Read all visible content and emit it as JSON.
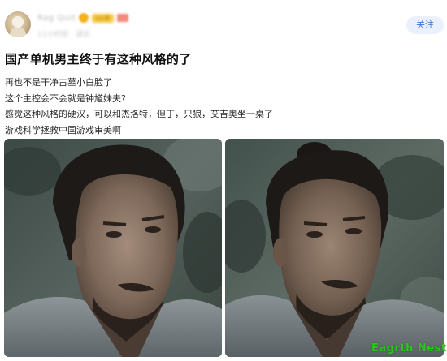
{
  "post": {
    "author": {
      "name": "Rag Quit",
      "badge": "Lv.8",
      "meta": "11小时前 · 湖北"
    },
    "follow_label": "关注",
    "title": "国产单机男主终于有这种风格的了",
    "lines": [
      "再也不是干净古墓小白脸了",
      "这个主控会不会就是钟馗妹夫?",
      "感觉这种风格的硬汉，可以和杰洛特，但丁，只狼，艾吉奥坐一桌了",
      "游戏科学拯救中国游戏审美啊"
    ]
  },
  "images": [
    {
      "description_icon": "portrait-photo-icon"
    },
    {
      "description_icon": "portrait-photo-icon"
    }
  ],
  "watermark": "Eagrth Nest",
  "colors": {
    "follow_bg": "#eaf1fd",
    "follow_text": "#3b74d8",
    "watermark": "#2ec71f"
  }
}
